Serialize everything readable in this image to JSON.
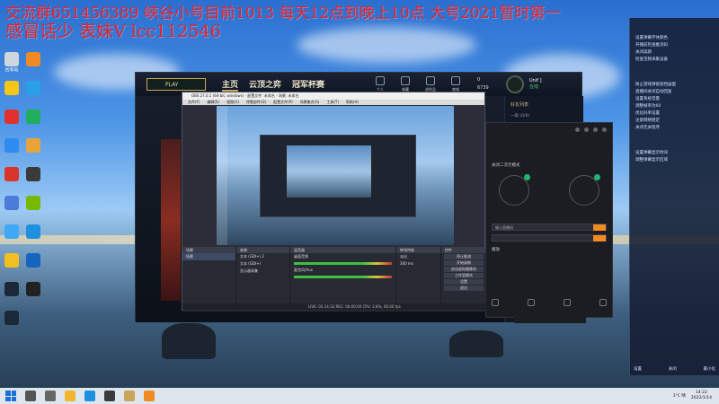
{
  "overlay": {
    "line1": "交流群651456389 峡谷小号目前1013 每天12点到晚上10点 大号2021暂时第一",
    "line2": "感冒话少 表妹V lcc112546"
  },
  "desktop_icons": [
    {
      "name": "recycle-bin-icon",
      "label": "回收站",
      "color": "#cfd6de"
    },
    {
      "name": "app-icon-1",
      "label": "",
      "color": "#f08a24"
    },
    {
      "name": "app-icon-2",
      "label": "",
      "color": "#f5c518"
    },
    {
      "name": "app-icon-3",
      "label": "",
      "color": "#2aa0e8"
    },
    {
      "name": "app-icon-4",
      "label": "",
      "color": "#e0312f"
    },
    {
      "name": "app-icon-5",
      "label": "",
      "color": "#1fae5b"
    },
    {
      "name": "app-icon-6",
      "label": "",
      "color": "#2d8cf0"
    },
    {
      "name": "app-icon-7",
      "label": "",
      "color": "#e8a43a"
    },
    {
      "name": "app-icon-8",
      "label": "",
      "color": "#d9352a"
    },
    {
      "name": "obs-icon",
      "label": "",
      "color": "#3a3a3a"
    },
    {
      "name": "app-icon-9",
      "label": "",
      "color": "#4c7bd9"
    },
    {
      "name": "nvidia-icon",
      "label": "",
      "color": "#76b900"
    },
    {
      "name": "app-icon-10",
      "label": "",
      "color": "#3fa9f5"
    },
    {
      "name": "edge-icon",
      "label": "",
      "color": "#1f8fe0"
    },
    {
      "name": "app-icon-11",
      "label": "",
      "color": "#f0c020"
    },
    {
      "name": "app-icon-12",
      "label": "",
      "color": "#1565c0"
    },
    {
      "name": "steam-icon",
      "label": "",
      "color": "#1b2838"
    },
    {
      "name": "qq-icon",
      "label": "",
      "color": "#222222"
    },
    {
      "name": "app-icon-13",
      "label": "",
      "color": "#1b2838"
    }
  ],
  "game": {
    "play_label": "PLAY",
    "nav": [
      "主页",
      "云顶之弈",
      "冠军杯赛"
    ],
    "icons": [
      "个人",
      "收藏",
      "战利品",
      "商城"
    ],
    "currency_rp": "0",
    "currency_be": "6739",
    "profile_name": "Unif ]",
    "profile_status": "在线",
    "friends_header": "好友列表",
    "friends_group": "一般 (0/6)"
  },
  "obs": {
    "title": "OBS 27.0.1 (64-bit, windows) - 配置文件: 未命名 - 场景: 未命名",
    "menu": [
      "文件(F)",
      "编辑(E)",
      "视图(V)",
      "停靠部件(D)",
      "配置文件(P)",
      "场景集合(S)",
      "工具(T)",
      "帮助(H)"
    ],
    "docks": {
      "scenes_title": "场景",
      "scenes_item": "场景",
      "sources_title": "来源",
      "sources": [
        "文本 (GDI+) 2",
        "文本 (GDI+)",
        "显示器采集"
      ],
      "mixer_title": "混音器",
      "mixer": [
        "桌面音频",
        "麦克风/Aux"
      ],
      "transitions_title": "转场特效",
      "transition_name": "淡出",
      "transition_duration": "300 ms",
      "controls_title": "控件",
      "controls": [
        "停止推流",
        "开始录制",
        "启动虚拟摄像机",
        "工作室模式",
        "设置",
        "退出"
      ]
    },
    "status": "LIVE: 02:14:32   REC: 00:00:00   CPU: 2.8%, 60.00 fps"
  },
  "tool": {
    "options": [
      "关闭二次元模式",
      "播放"
    ],
    "field_placeholder": "输入直播间"
  },
  "notes": {
    "lines_top": [
      "设置弹幕字体颜色",
      "开播前检查推流码",
      "关闭美颜",
      "检查音频采集设备"
    ],
    "lines_mid": [
      "防止游戏弹窗遮挡画面",
      "直播间关闭自动回复",
      "设置系统音量",
      "调整帧率为60",
      "优化码率设置",
      "注意网络稳定",
      "关闭无关程序"
    ],
    "lines_low": [
      "设置弹幕显示时间",
      "调整弹幕显示区域"
    ],
    "footer": [
      "设置",
      "关闭",
      "最小化"
    ]
  },
  "taskbar": {
    "apps": [
      {
        "name": "search-taskbar-icon",
        "color": "#555555"
      },
      {
        "name": "taskview-taskbar-icon",
        "color": "#666666"
      },
      {
        "name": "explorer-taskbar-icon",
        "color": "#f2b530"
      },
      {
        "name": "edge-taskbar-icon",
        "color": "#1f8fe0"
      },
      {
        "name": "obs-taskbar-icon",
        "color": "#3a3a3a"
      },
      {
        "name": "game-taskbar-icon",
        "color": "#c9a55a"
      },
      {
        "name": "tool-taskbar-icon",
        "color": "#f08a24"
      }
    ],
    "tray_weather": "3°C 晴",
    "time": "14:22",
    "date": "2022/1/14"
  }
}
